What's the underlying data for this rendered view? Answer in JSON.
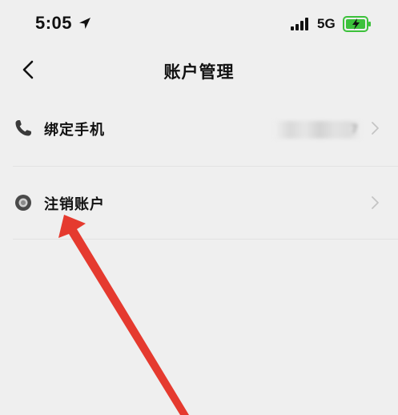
{
  "status_bar": {
    "time": "5:05",
    "network": "5G",
    "icons": [
      "location-arrow-icon",
      "signal-bars-icon",
      "battery-charging-icon"
    ],
    "battery_color": "#3cc13b"
  },
  "nav": {
    "title": "账户管理",
    "back_icon": "chevron-left-icon"
  },
  "rows": [
    {
      "icon": "phone-icon",
      "label": "绑定手机",
      "value_masked": true,
      "value_visible_suffix": "7",
      "chevron": "chevron-right-icon"
    },
    {
      "icon": "radio-circle-icon",
      "label": "注销账户",
      "chevron": "chevron-right-icon"
    }
  ],
  "annotation": {
    "type": "arrow",
    "color": "#e53a2f",
    "points_to": "注销账户"
  },
  "colors": {
    "background": "#efefef",
    "text": "#111111",
    "chevron": "#c4c4c4",
    "divider": "#e2e2e2"
  }
}
